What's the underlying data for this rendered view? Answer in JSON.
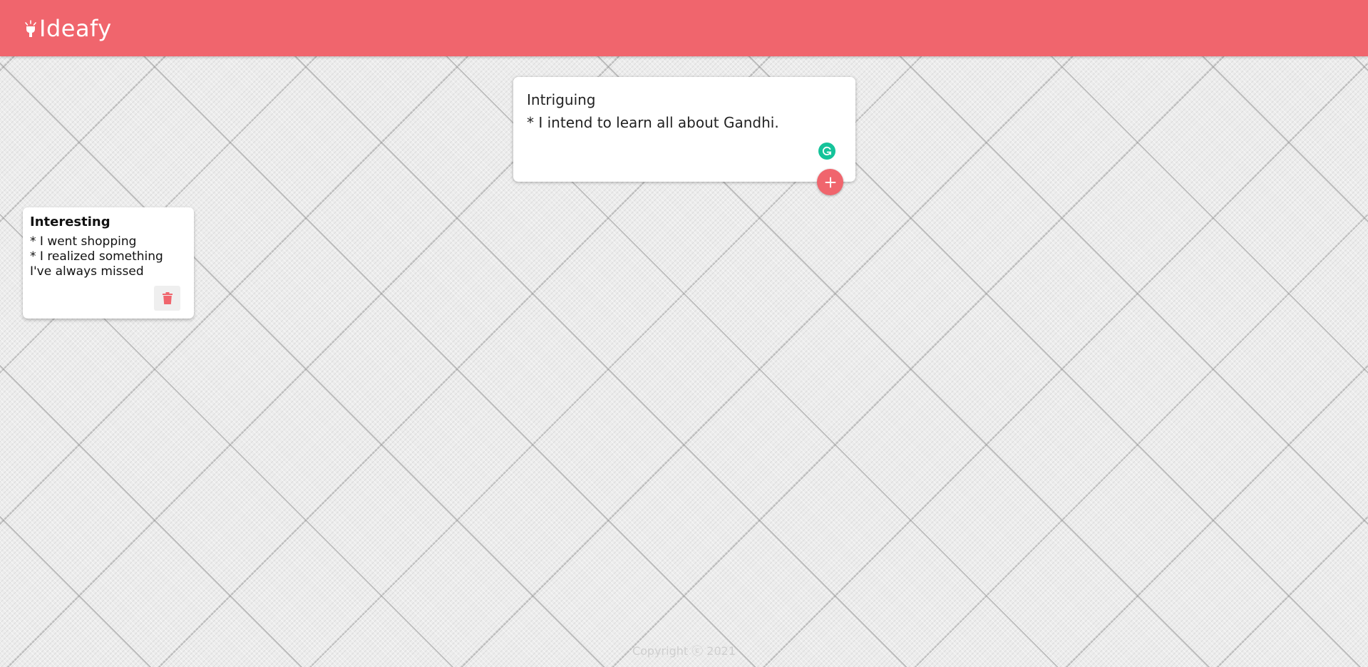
{
  "header": {
    "app_name": "Ideafy",
    "logo_icon": "lightbulb-icon"
  },
  "create_area": {
    "title_value": "Intriguing",
    "content_value": "* I intend to learn all about Gandhi.",
    "grammarly_icon": "grammarly-icon",
    "add_icon": "plus-icon"
  },
  "notes": [
    {
      "title": "Interesting",
      "content": "* I went shopping\n* I realized something I've always missed",
      "delete_icon": "trash-icon"
    }
  ],
  "footer": {
    "text": "Copyright ⓒ 2021"
  },
  "colors": {
    "brand": "#f0656d",
    "grammarly": "#15c39a",
    "footer_text": "#cfcfcf"
  }
}
